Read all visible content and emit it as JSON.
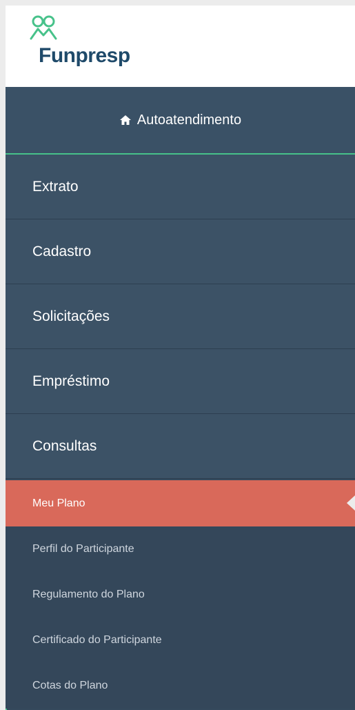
{
  "brand": {
    "name": "Funpresp",
    "logo_icon": "people-logo-icon",
    "accent": "#47c28a",
    "text_color": "#1f4a6a"
  },
  "header": {
    "icon": "home-icon",
    "label": "Autoatendimento"
  },
  "nav": {
    "items": [
      {
        "label": "Extrato"
      },
      {
        "label": "Cadastro"
      },
      {
        "label": "Solicitações"
      },
      {
        "label": "Empréstimo"
      },
      {
        "label": "Consultas"
      }
    ],
    "submenu": {
      "active": "Meu Plano",
      "active_color": "#d9695a",
      "items": [
        {
          "label": "Perfil do Participante"
        },
        {
          "label": "Regulamento do Plano"
        },
        {
          "label": "Certificado do Participante"
        },
        {
          "label": "Cotas do Plano"
        }
      ]
    }
  }
}
